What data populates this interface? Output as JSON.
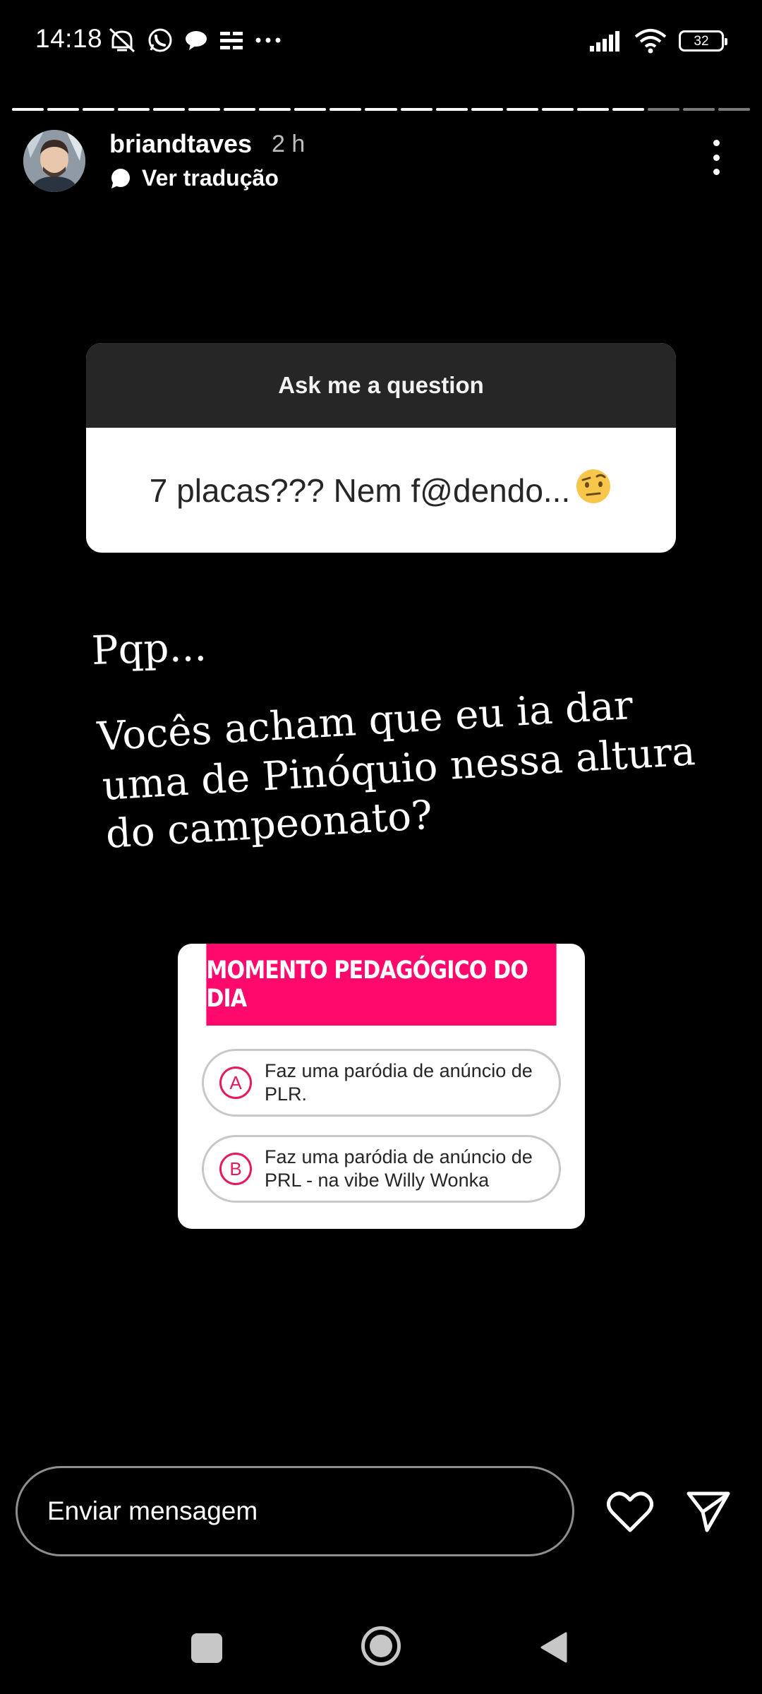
{
  "status_bar": {
    "time": "14:18",
    "battery": "32",
    "left_icons": [
      "mute-icon",
      "whatsapp-icon",
      "chat-bubble-icon",
      "news-icon",
      "more-notifications-icon"
    ],
    "right_icons": [
      "signal-icon",
      "wifi-icon",
      "battery-icon"
    ]
  },
  "story": {
    "segments_total": 21,
    "segments_done": 18,
    "username": "briandtaves",
    "time_ago": "2 h",
    "translate_label": "Ver tradução"
  },
  "question_sticker": {
    "header": "Ask me a question",
    "answer": "7 placas??? Nem f@dendo...",
    "answer_emoji": "🤨"
  },
  "caption": {
    "line0": "Pqp...",
    "line1": "Vocês acham que eu ia dar",
    "line2": "uma de Pinóquio nessa altura",
    "line3": "do campeonato?"
  },
  "quiz_sticker": {
    "title": "MOMENTO PEDAGÓGICO DO DIA",
    "options": [
      {
        "letter": "A",
        "text": "Faz uma paródia de anúncio de PLR."
      },
      {
        "letter": "B",
        "text": "Faz uma paródia de anúncio de PRL - na vibe Willy Wonka"
      }
    ],
    "accent_color": "#ff0a6c"
  },
  "message_bar": {
    "placeholder": "Enviar mensagem"
  }
}
